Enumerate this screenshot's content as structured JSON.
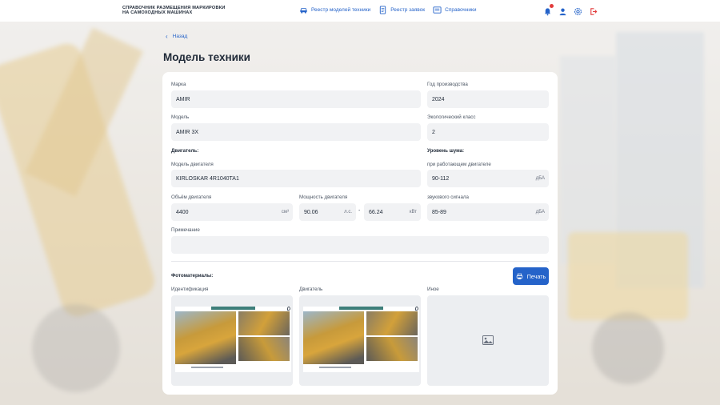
{
  "header": {
    "logo_line1": "СПРАВОЧНИК РАЗМЕЩЕНИЯ МАРКИРОВКИ",
    "logo_line2": "НА САМОХОДНЫХ МАШИНАХ",
    "nav": [
      {
        "label": "Реестр моделей техники",
        "icon": "car-icon"
      },
      {
        "label": "Реестр заявок",
        "icon": "document-icon"
      },
      {
        "label": "Справочники",
        "icon": "book-icon"
      }
    ],
    "icons": [
      "bell-icon",
      "user-icon",
      "settings-icon",
      "logout-icon"
    ],
    "accent": "#2563c9",
    "notification_color": "#e23b3b"
  },
  "back_label": "Назад",
  "page_title": "Модель техники",
  "form": {
    "brand_label": "Марка",
    "brand_value": "AMIR",
    "year_label": "Год производства",
    "year_value": "2024",
    "model_label": "Модель",
    "model_value": "AMIR 3X",
    "eco_label": "Экологический класс",
    "eco_value": "2",
    "engine_section": "Двигатель:",
    "noise_section": "Уровень шума:",
    "engine_model_label": "Модель двигателя",
    "engine_model_value": "KIRLOSKAR 4R1040TA1",
    "noise_running_label": "при работающем двигателе",
    "noise_running_value": "90-112",
    "noise_running_unit": "дБА",
    "volume_label": "Объём двигателя",
    "volume_value": "4400",
    "volume_unit": "см³",
    "power_label": "Мощность двигателя",
    "power_hp_value": "90.06",
    "power_hp_unit": "л.с.",
    "power_sep": "-",
    "power_kw_value": "66.24",
    "power_kw_unit": "кВт",
    "noise_signal_label": "звукового сигнала",
    "noise_signal_value": "85-89",
    "noise_signal_unit": "дБА",
    "note_label": "Примечание",
    "note_value": ""
  },
  "photos": {
    "section": "Фотоматериалы:",
    "print_label": "Печать",
    "identification_label": "Идентификация",
    "engine_label": "Двигатель",
    "other_label": "Иное"
  }
}
